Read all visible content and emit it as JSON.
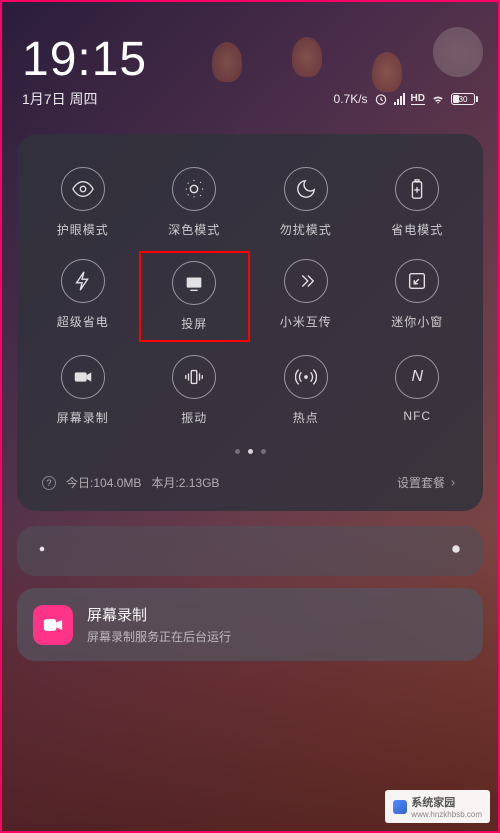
{
  "statusBar": {
    "time": "19:15",
    "date": "1月7日 周四",
    "networkSpeed": "0.7K/s",
    "hdLabel": "HD",
    "batteryPercent": "30"
  },
  "quickSettings": {
    "toggles": [
      {
        "label": "护眼模式",
        "icon": "eye"
      },
      {
        "label": "深色模式",
        "icon": "dark-mode"
      },
      {
        "label": "勿扰模式",
        "icon": "moon"
      },
      {
        "label": "省电模式",
        "icon": "battery-plus"
      },
      {
        "label": "超级省电",
        "icon": "bolt"
      },
      {
        "label": "投屏",
        "icon": "cast",
        "highlighted": true
      },
      {
        "label": "小米互传",
        "icon": "mi-share"
      },
      {
        "label": "迷你小窗",
        "icon": "mini-window"
      },
      {
        "label": "屏幕录制",
        "icon": "video"
      },
      {
        "label": "振动",
        "icon": "vibrate"
      },
      {
        "label": "热点",
        "icon": "hotspot"
      },
      {
        "label": "NFC",
        "icon": "nfc"
      }
    ],
    "currentPage": 1,
    "totalPages": 3
  },
  "dataUsage": {
    "todayLabel": "今日:",
    "todayValue": "104.0MB",
    "monthLabel": "本月:",
    "monthValue": "2.13GB",
    "configLabel": "设置套餐"
  },
  "notification": {
    "title": "屏幕录制",
    "subtitle": "屏幕录制服务正在后台运行"
  },
  "watermark": {
    "text": "系统家园",
    "url": "www.hnzkhbsb.com"
  }
}
